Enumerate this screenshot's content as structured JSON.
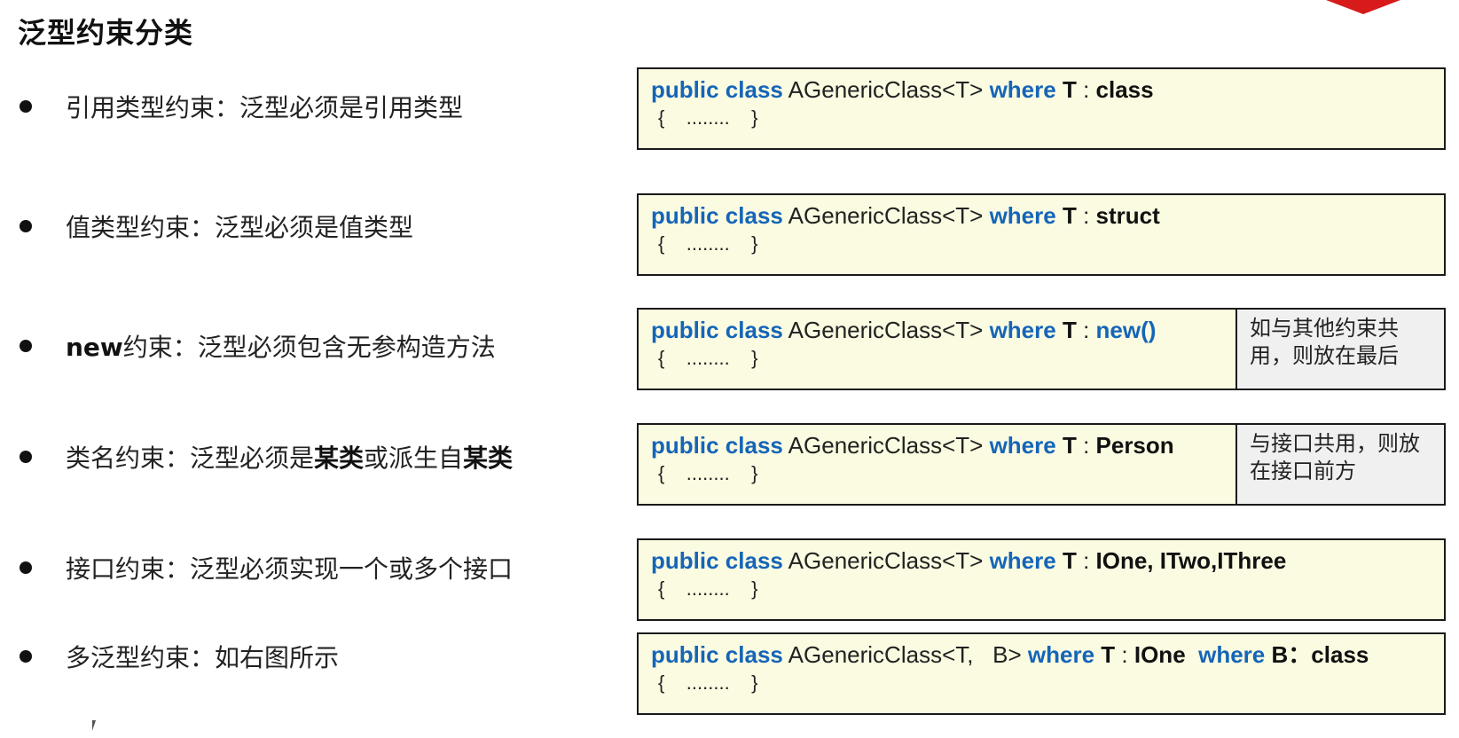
{
  "slide": {
    "title": "泛型约束分类",
    "accent_color": "#d71a1a",
    "keyword_color": "#1565b8",
    "code_bg_color": "#fbfbe1",
    "note_bg_color": "#f0f0f0"
  },
  "bullets": [
    {
      "plain1": "引用类型约束：泛型必须是引用类型",
      "bold1": "",
      "plain2": "",
      "bold2": ""
    },
    {
      "plain1": "值类型约束：泛型必须是值类型",
      "bold1": "",
      "plain2": "",
      "bold2": ""
    },
    {
      "bold0": "new",
      "plain1": "约束：泛型必须包含无参构造方法"
    },
    {
      "plain1": "类名约束：泛型必须是",
      "bold1": "某类",
      "plain2": "或派生自",
      "bold2": "某类"
    },
    {
      "plain1": "接口约束：泛型必须实现一个或多个接口"
    },
    {
      "plain1": "多泛型约束：如右图所示"
    }
  ],
  "code": {
    "kw_public": "public",
    "kw_class": "class",
    "kw_where": "where",
    "class_name": "AGenericClass<T>",
    "class_name_multi": "AGenericClass<T,   B>",
    "type_t": "T",
    "type_b": "B",
    "colon": " : ",
    "colon_cn": "：",
    "body": "{    ........    }",
    "constraint_class": "class",
    "constraint_struct": "struct",
    "constraint_new": "new()",
    "constraint_person": "Person",
    "constraint_interfaces": "IOne, ITwo,IThree",
    "constraint_ione": "IOne",
    "constraint_b_class": "class"
  },
  "notes": {
    "new_note": "如与其他约束共用，则放在最后",
    "person_note": "与接口共用，则放在接口前方"
  }
}
